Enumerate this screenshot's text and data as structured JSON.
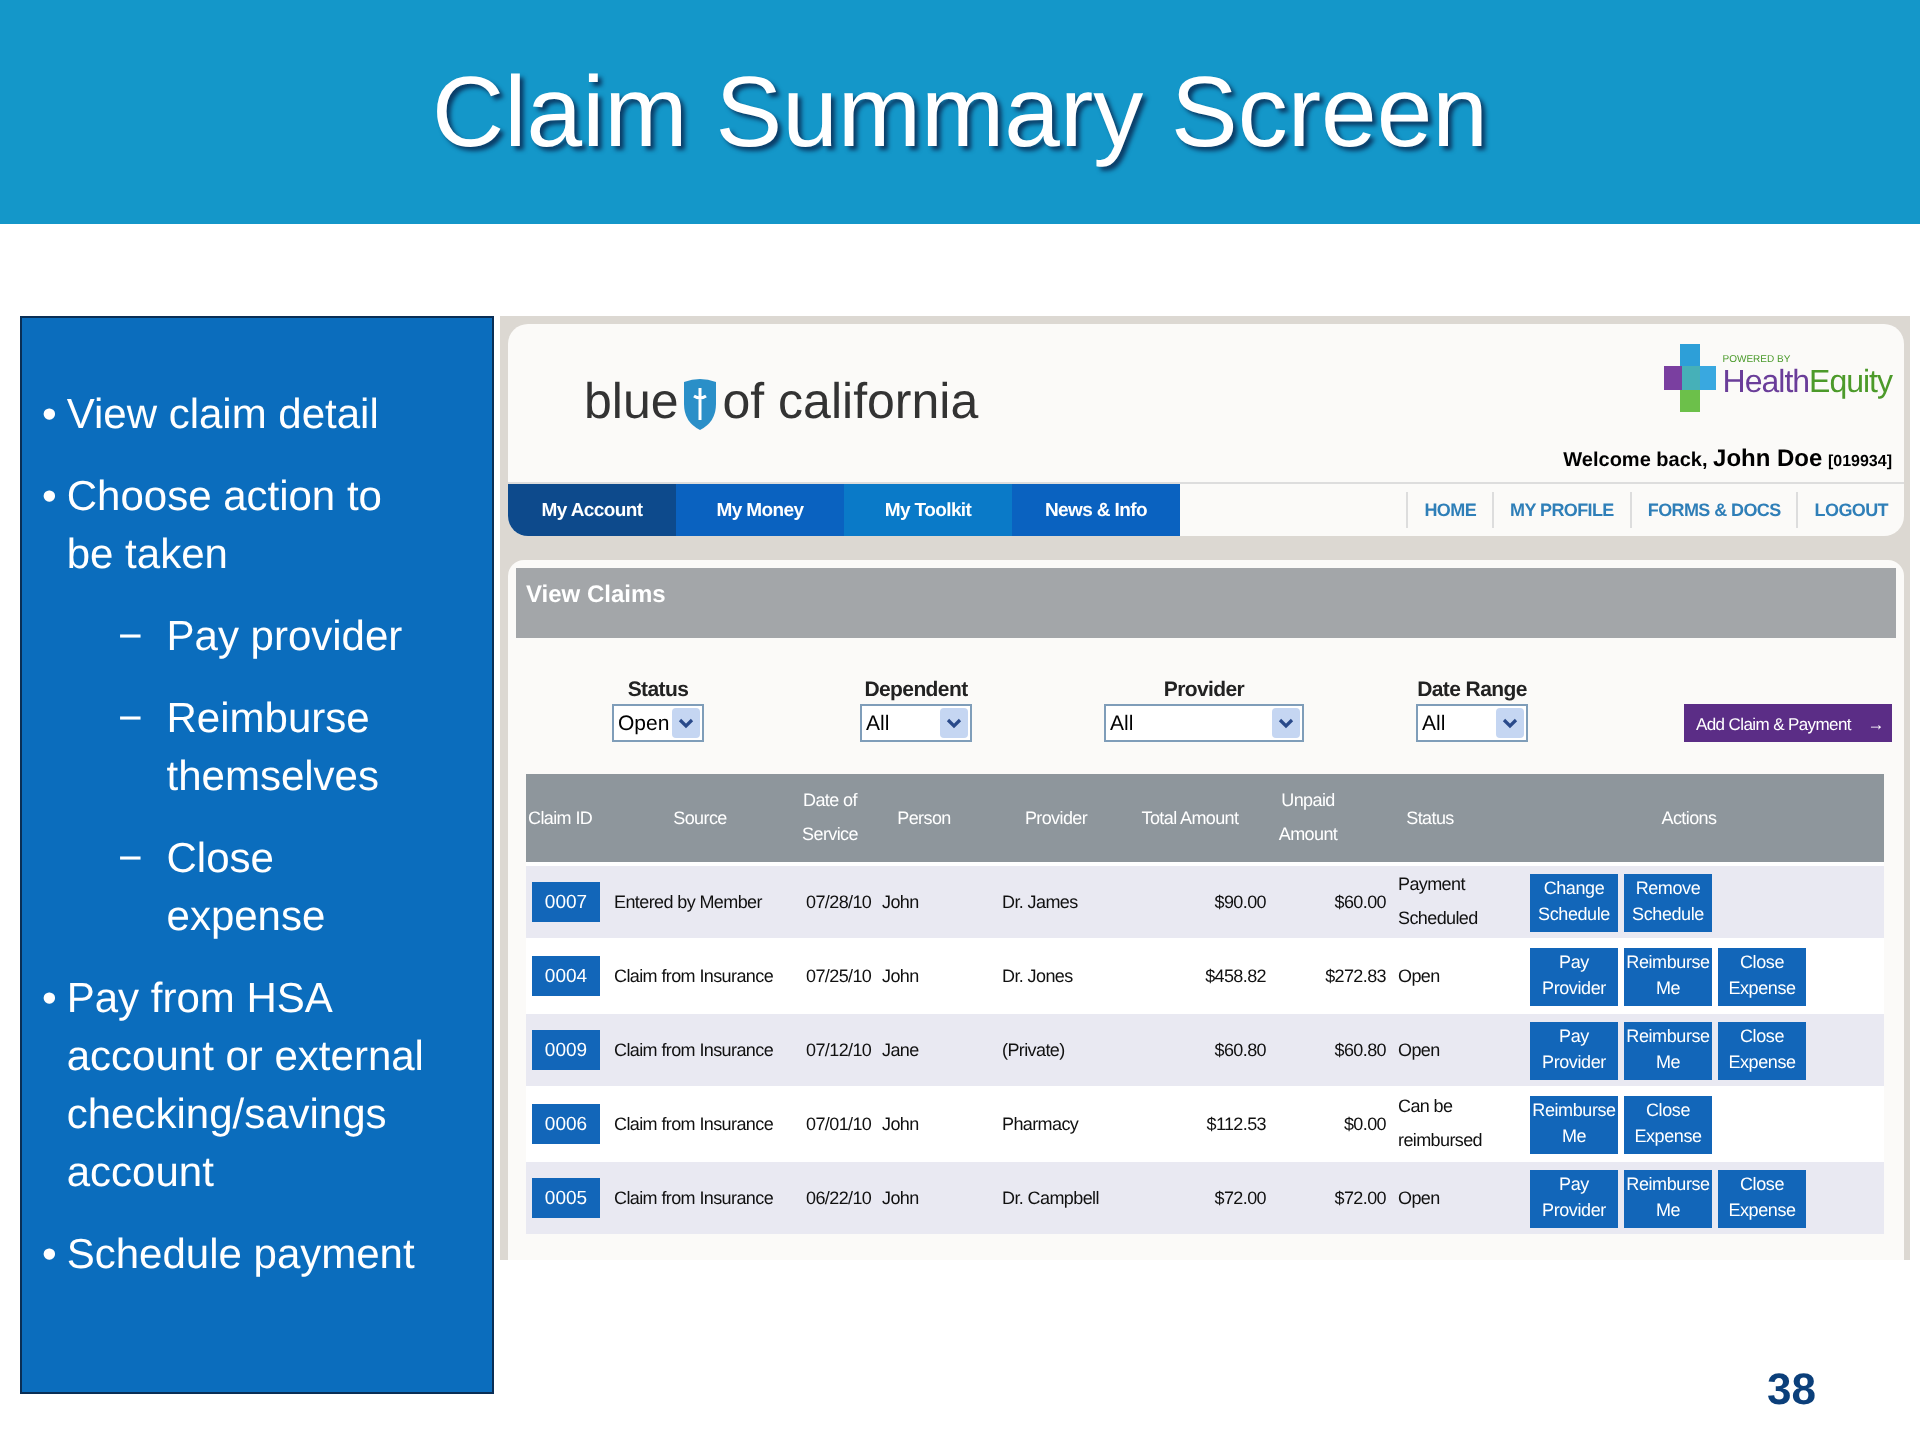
{
  "slide": {
    "title": "Claim Summary Screen",
    "page_number": "38"
  },
  "bullets": [
    {
      "marker": "•",
      "text": "View claim detail"
    },
    {
      "marker": "•",
      "text": "Choose action to be taken",
      "children": [
        {
          "marker": "−",
          "text": "Pay provider"
        },
        {
          "marker": "−",
          "text": "Reimburse themselves"
        },
        {
          "marker": "−",
          "text": "Close expense"
        }
      ]
    },
    {
      "marker": "•",
      "text": "Pay from HSA account or external checking/savings account"
    },
    {
      "marker": "•",
      "text": "Schedule payment"
    }
  ],
  "app": {
    "brand": {
      "before": "blue",
      "after": "of california"
    },
    "partner": {
      "tagline": "POWERED BY",
      "name_a": "Health",
      "name_b": "Equity"
    },
    "welcome": {
      "text": "Welcome back,",
      "name": "John Doe",
      "id": "[019934]"
    },
    "tabs": [
      {
        "label": "My Account",
        "selected": true
      },
      {
        "label": "My Money",
        "selected": false
      },
      {
        "label": "My Toolkit",
        "selected": false
      },
      {
        "label": "News & Info",
        "selected": false
      }
    ],
    "links": [
      "HOME",
      "MY PROFILE",
      "FORMS & DOCS",
      "LOGOUT"
    ],
    "panel_title": "View Claims",
    "filters": [
      {
        "label": "Status",
        "value": "Open"
      },
      {
        "label": "Dependent",
        "value": "All"
      },
      {
        "label": "Provider",
        "value": "All"
      },
      {
        "label": "Date Range",
        "value": "All"
      }
    ],
    "add_button": {
      "label": "Add Claim & Payment",
      "arrow": "→"
    },
    "columns": [
      "Claim ID",
      "Source",
      "Date of Service",
      "Person",
      "Provider",
      "Total Amount",
      "Unpaid Amount",
      "Status",
      "Actions"
    ],
    "rows": [
      {
        "id": "0007",
        "source": "Entered by Member",
        "date": "07/28/10",
        "person": "John",
        "provider": "Dr. James",
        "total": "$90.00",
        "unpaid": "$60.00",
        "status": "Payment Scheduled",
        "actions": [
          "Change Schedule",
          "Remove Schedule"
        ]
      },
      {
        "id": "0004",
        "source": "Claim from Insurance",
        "date": "07/25/10",
        "person": "John",
        "provider": "Dr. Jones",
        "total": "$458.82",
        "unpaid": "$272.83",
        "status": "Open",
        "actions": [
          "Pay Provider",
          "Reimburse Me",
          "Close Expense"
        ]
      },
      {
        "id": "0009",
        "source": "Claim from Insurance",
        "date": "07/12/10",
        "person": "Jane",
        "provider": "(Private)",
        "total": "$60.80",
        "unpaid": "$60.80",
        "status": "Open",
        "actions": [
          "Pay Provider",
          "Reimburse Me",
          "Close Expense"
        ]
      },
      {
        "id": "0006",
        "source": "Claim from Insurance",
        "date": "07/01/10",
        "person": "John",
        "provider": "Pharmacy",
        "total": "$112.53",
        "unpaid": "$0.00",
        "status": "Can be reimbursed",
        "actions": [
          "Reimburse Me",
          "Close Expense"
        ]
      },
      {
        "id": "0005",
        "source": "Claim from Insurance",
        "date": "06/22/10",
        "person": "John",
        "provider": "Dr. Campbell",
        "total": "$72.00",
        "unpaid": "$72.00",
        "status": "Open",
        "actions": [
          "Pay Provider",
          "Reimburse Me",
          "Close Expense"
        ]
      }
    ]
  }
}
